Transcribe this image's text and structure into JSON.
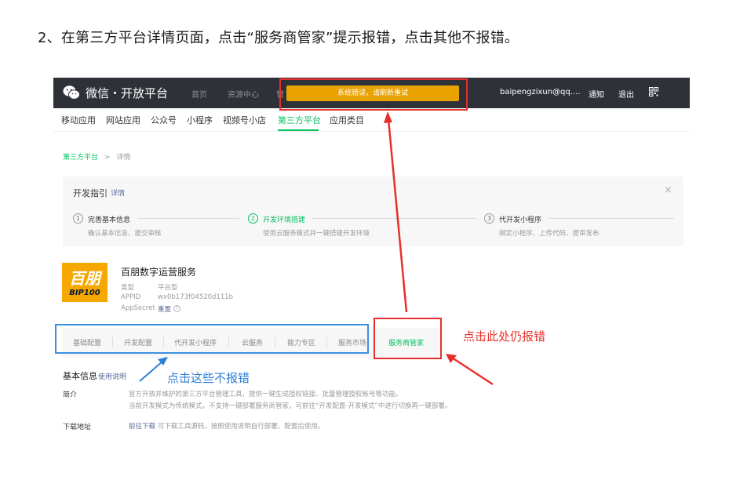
{
  "heading": "2、在第三方平台详情页面，点击“服务商管家”提示报错，点击其他不报错。",
  "topbar": {
    "brand": "微信・开放平台",
    "nav": [
      "首页",
      "资源中心"
    ],
    "nav_clipped": "管",
    "error_toast": "系统错误，请刷新重试",
    "account": "baipengzixun@qq....",
    "notify": "通知",
    "logout": "退出"
  },
  "subnav": [
    "移动应用",
    "网站应用",
    "公众号",
    "小程序",
    "视频号小店",
    "第三方平台",
    "应用类目"
  ],
  "breadcrumb": {
    "parent": "第三方平台",
    "separator": ">",
    "current": "详情"
  },
  "guide": {
    "title": "开发指引",
    "link": "详情",
    "close": "×",
    "steps": [
      {
        "num": "1",
        "title": "完善基本信息",
        "desc": "确认基本信息、提交审核"
      },
      {
        "num": "2",
        "title": "开发环境搭建",
        "desc": "使用云服务模式并一键搭建开发环境"
      },
      {
        "num": "3",
        "title": "代开发小程序",
        "desc": "绑定小程序、上传代码、提审发布"
      }
    ]
  },
  "app": {
    "logo_main": "百朋",
    "logo_sub": "BIP100",
    "name": "百朋数字运营服务",
    "type_label": "类型",
    "type_value": "平台型",
    "appid_label": "APPID",
    "appid_value": "wx0b173f04520d111b",
    "secret_label": "AppSecret",
    "secret_link": "重置",
    "help": "?"
  },
  "tabs": [
    "基础配置",
    "开发配置",
    "代开发小程序",
    "云服务",
    "能力专区",
    "服务市场",
    "服务商管家"
  ],
  "annotations": {
    "red": "点击此处仍报错",
    "blue": "点击这些不报错"
  },
  "basic_info": {
    "title": "基本信息",
    "link": "使用说明",
    "intro_label": "简介",
    "intro_line1": "官方开放并维护的第三方平台管理工具，提供一键生成授权链接、批量管理授权帐号等功能。",
    "intro_line2": "当前开发模式为传统模式，不支持一键部署服务商管家，可前往“开发配置-开发模式”中进行切换再一键部署。",
    "download_label": "下载地址",
    "download_link": "前往下载",
    "download_text": " 可下载工具源码，按照使用说明自行部署、配置后使用。"
  },
  "colors": {
    "wechat_green": "#07c160",
    "topbar_dark": "#2e3238",
    "toast_orange": "#e9a200",
    "annotation_red": "#e8302a",
    "annotation_blue": "#3d8fe0",
    "link_blue": "#576b95"
  }
}
